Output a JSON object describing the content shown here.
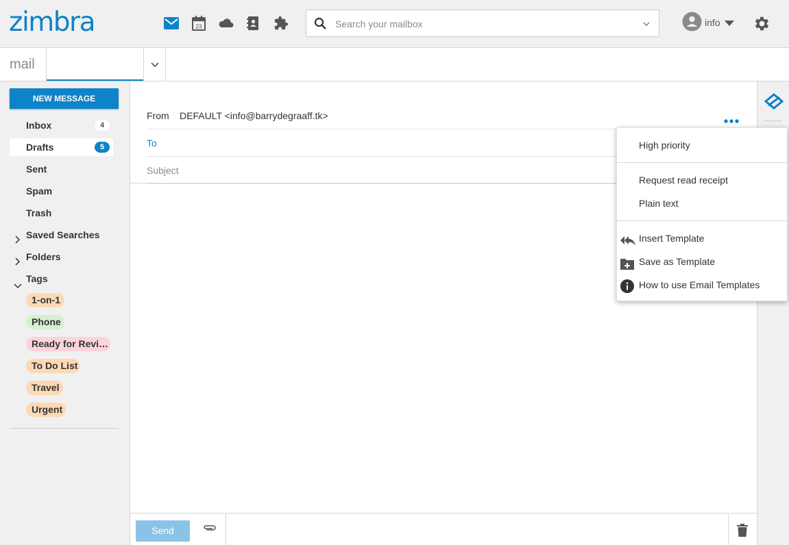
{
  "header": {
    "logo": "zimbra",
    "apps": [
      {
        "icon": "mail-icon",
        "name": "Mail"
      },
      {
        "icon": "calendar-icon",
        "name": "Calendar",
        "date": "23"
      },
      {
        "icon": "cloud-icon",
        "name": "Briefcase"
      },
      {
        "icon": "contacts-icon",
        "name": "Contacts"
      },
      {
        "icon": "puzzle-icon",
        "name": "Integrations"
      }
    ],
    "search_placeholder": "Search your mailbox",
    "account_name": "info"
  },
  "tabs": {
    "mail_label": "mail"
  },
  "sidebar": {
    "new_message": "NEW MESSAGE",
    "folders": [
      {
        "label": "Inbox",
        "count": "4"
      },
      {
        "label": "Drafts",
        "count": "5"
      },
      {
        "label": "Sent"
      },
      {
        "label": "Spam"
      },
      {
        "label": "Trash"
      }
    ],
    "groups": [
      {
        "label": "Saved Searches"
      },
      {
        "label": "Folders"
      },
      {
        "label": "Tags"
      }
    ],
    "tags": [
      {
        "label": "1-on-1",
        "color": "#fcd9b4"
      },
      {
        "label": "Phone",
        "color": "#d7efd0"
      },
      {
        "label": "Ready for Revi…",
        "color": "#fbd3dc"
      },
      {
        "label": "To Do List",
        "color": "#fcd9b4"
      },
      {
        "label": "Travel",
        "color": "#fcd9b4"
      },
      {
        "label": "Urgent",
        "color": "#fcd9b4"
      }
    ]
  },
  "compose": {
    "from_label": "From",
    "from_value": "DEFAULT <info@barrydegraaff.tk>",
    "to_label": "To",
    "subject_label": "Subject",
    "send_label": "Send"
  },
  "menu": {
    "items": [
      {
        "label": "High priority"
      },
      {
        "label": "Request read receipt"
      },
      {
        "label": "Plain text"
      },
      {
        "label": "Insert Template",
        "icon": "reply-all-icon"
      },
      {
        "label": "Save as Template",
        "icon": "folder-add-icon"
      },
      {
        "label": "How to use Email Templates",
        "icon": "info-icon"
      }
    ]
  },
  "colors": {
    "accent": "#0d83c8",
    "send_disabled": "#8bc3e6"
  }
}
